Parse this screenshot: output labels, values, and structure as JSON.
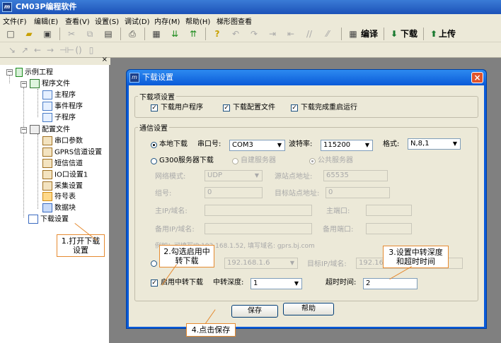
{
  "app": {
    "title": "CM03P编程软件"
  },
  "menu": [
    "文件(F)",
    "编辑(E)",
    "查看(V)",
    "设置(S)",
    "调试(D)",
    "内存(M)",
    "帮助(H)",
    "梯形图查看"
  ],
  "toolbar": {
    "compile_label": "编译",
    "download_label": "下载",
    "upload_label": "上传"
  },
  "tree": {
    "root": "示例工程",
    "program_files": "程序文件",
    "main_program": "主程序",
    "event_program": "事件程序",
    "sub_program": "子程序",
    "config_files": "配置文件",
    "serial_params": "串口参数",
    "gprs_settings": "GPRS信道设置",
    "sms_channel": "短信信道",
    "io_settings": "IO口设置1",
    "collect_settings": "采集设置",
    "symbol_table": "符号表",
    "data_block": "数据块",
    "download_settings": "下载设置"
  },
  "dialog": {
    "title": "下载设置",
    "download_items_group": "下载项设置",
    "chk_download_user_program": "下载用户程序",
    "chk_download_config": "下载配置文件",
    "chk_restart_after": "下载完成重启运行",
    "comm_group": "通信设置",
    "local_download": "本地下载",
    "serial_port_label": "串口号:",
    "serial_port_value": "COM3",
    "baud_label": "波特率:",
    "baud_value": "115200",
    "format_label": "格式:",
    "format_value": "N,8,1",
    "g300_download": "G300服务器下载",
    "self_server": "自建服务器",
    "public_server": "公共服务器",
    "net_mode_label": "网络模式:",
    "net_mode_value": "UDP",
    "src_addr_label": "源站点地址:",
    "src_addr_value": "65535",
    "group_label": "组号:",
    "group_value": "0",
    "target_addr_label": "目标站点地址:",
    "target_addr_value": "0",
    "main_ip_label": "主IP/域名:",
    "main_port_label": "主端口:",
    "backup_ip_label": "备用IP/域名:",
    "backup_port_label": "备用端口:",
    "example_text": "例如：可填写IP:192.168.1.52, 填写域名: gprs.bj.com",
    "relay_ip_value": "192.168.1.6",
    "target_ip_label": "目标IP/域名:",
    "target_ip_value": "192.16",
    "enable_relay": "启用中转下载",
    "relay_depth_label": "中转深度:",
    "relay_depth_value": "1",
    "timeout_label": "超时时间:",
    "timeout_value": "2",
    "save_button": "保存",
    "help_button": "帮助"
  },
  "callouts": {
    "c1": "1.打开下载设置",
    "c2": "2.勾选启用中转下载",
    "c3": "3.设置中转深度和超时时间",
    "c4": "4.点击保存"
  },
  "colors": {
    "callout_border": "#e58a30",
    "dialog_frame": "#0a5ad8"
  }
}
